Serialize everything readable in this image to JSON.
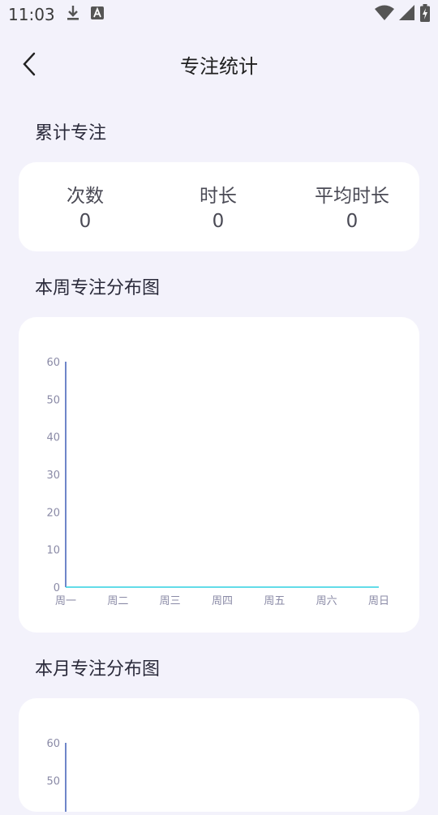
{
  "status_bar": {
    "time": "11:03",
    "icons": [
      "download-icon",
      "text-a-icon",
      "wifi-icon",
      "signal-icon",
      "battery-charging-icon"
    ]
  },
  "header": {
    "title": "专注统计",
    "back_icon": "chevron-left-icon"
  },
  "cumulative": {
    "section_title": "累计专注",
    "stats": [
      {
        "label": "次数",
        "value": "0"
      },
      {
        "label": "时长",
        "value": "0"
      },
      {
        "label": "平均时长",
        "value": "0"
      }
    ]
  },
  "weekly": {
    "section_title": "本周专注分布图"
  },
  "monthly": {
    "section_title": "本月专注分布图"
  },
  "chart_data": [
    {
      "type": "line",
      "categories": [
        "周一",
        "周二",
        "周三",
        "周四",
        "周五",
        "周六",
        "周日"
      ],
      "series": [
        {
          "values": [
            0,
            0,
            0,
            0,
            0,
            0,
            0
          ],
          "color": "#2fd0e0"
        }
      ],
      "yticks": [
        0,
        10,
        20,
        30,
        40,
        50,
        60
      ],
      "ylim": [
        0,
        60
      ],
      "grid": false,
      "axis_color": "#6f86c9"
    },
    {
      "type": "line",
      "yticks": [
        60,
        50
      ],
      "ylim": [
        0,
        60
      ],
      "partially_visible": true,
      "axis_color": "#6f86c9"
    }
  ]
}
